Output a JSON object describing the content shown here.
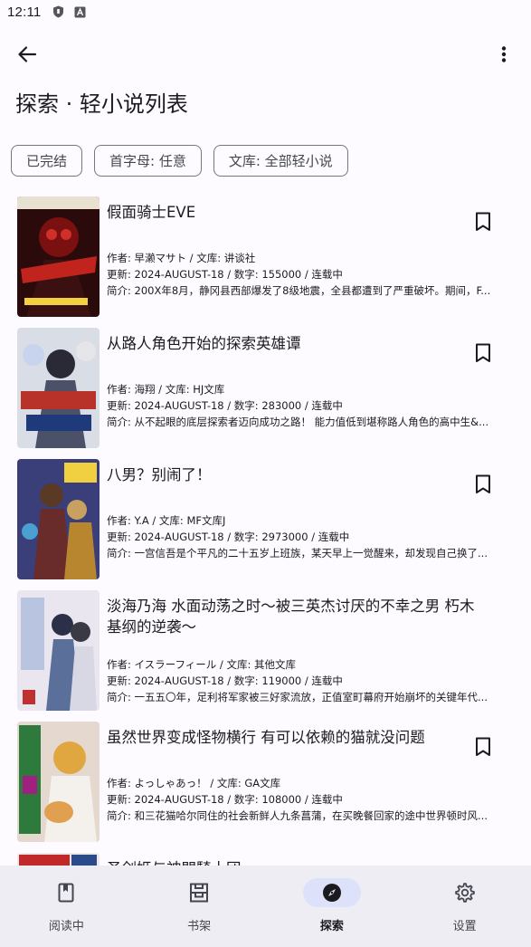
{
  "status": {
    "time": "12:11",
    "icons": [
      "shield-icon",
      "a-box-icon"
    ]
  },
  "app_bar": {
    "back_icon": "arrow-left-icon",
    "more_icon": "more-vert-icon"
  },
  "page": {
    "title": "探索 · 轻小说列表"
  },
  "filters": [
    {
      "label": "已完结"
    },
    {
      "label": "首字母: 任意"
    },
    {
      "label": "文库: 全部轻小说"
    }
  ],
  "books": [
    {
      "title": "假面骑士EVE",
      "author_line": "作者: 早濑マサト / 文库: 讲谈社",
      "update_line": "更新: 2024-AUGUST-18 / 数字: 155000 / 连载中",
      "intro_line": "简介: 200X年8月，静冈县西部爆发了8级地震，全县都遭到了严重破坏。期间，F...",
      "cover_colors": [
        "#7a1010",
        "#2a0a0a",
        "#c0241c"
      ]
    },
    {
      "title": "从路人角色开始的探索英雄谭",
      "author_line": "作者: 海翔 / 文库: HJ文库",
      "update_line": "更新: 2024-AUGUST-18 / 数字: 283000 / 连载中",
      "intro_line": "简介: 从不起眼的底层探索者迈向成功之路！ 能力值低到堪称路人角色的高中生&...",
      "cover_colors": [
        "#d8dde6",
        "#4a5168",
        "#b8322a"
      ]
    },
    {
      "title": "八男？别闹了！",
      "author_line": "作者: Y.A / 文库: MF文库J",
      "update_line": "更新: 2024-AUGUST-18 / 数字: 2973000 / 连载中",
      "intro_line": "简介: 一宫信吾是个平凡的二十五岁上班族，某天早上一觉醒来，却发现自己换了...",
      "cover_colors": [
        "#3a3f7a",
        "#b8862e",
        "#6a2b2b"
      ]
    },
    {
      "title": "淡海乃海 水面动荡之时～被三英杰讨厌的不幸之男 朽木基纲的逆袭～",
      "author_line": "作者: イスラーフィール / 文库: 其他文库",
      "update_line": "更新: 2024-AUGUST-18 / 数字: 119000 / 连载中",
      "intro_line": "简介: 一五五〇年，足利将军家被三好家流放，正值室町幕府开始崩坏的关键年代...",
      "cover_colors": [
        "#e9e6ef",
        "#5a6f9a",
        "#2b3048"
      ]
    },
    {
      "title": "虽然世界变成怪物横行 有可以依赖的猫就没问题",
      "author_line": "作者: よっしゃあっ！ / 文库: GA文库",
      "update_line": "更新: 2024-AUGUST-18 / 数字: 108000 / 连载中",
      "intro_line": "简介: 和三花猫哈尔同住的社会新鲜人九条菖蒲，在买晚餐回家的途中世界顿时风...",
      "cover_colors": [
        "#e4d8cf",
        "#e0a640",
        "#2d7a3c"
      ]
    },
    {
      "title": "圣剑姬与神門騎士团",
      "author_line": "",
      "update_line": "",
      "intro_line": "",
      "cover_colors": [
        "#f0e8e8",
        "#c0282a",
        "#2a4a8a"
      ]
    }
  ],
  "bottom_nav": [
    {
      "label": "阅读中",
      "icon": "book-icon",
      "active": false
    },
    {
      "label": "书架",
      "icon": "shelf-icon",
      "active": false
    },
    {
      "label": "探索",
      "icon": "compass-icon",
      "active": true
    },
    {
      "label": "设置",
      "icon": "gear-icon",
      "active": false
    }
  ]
}
